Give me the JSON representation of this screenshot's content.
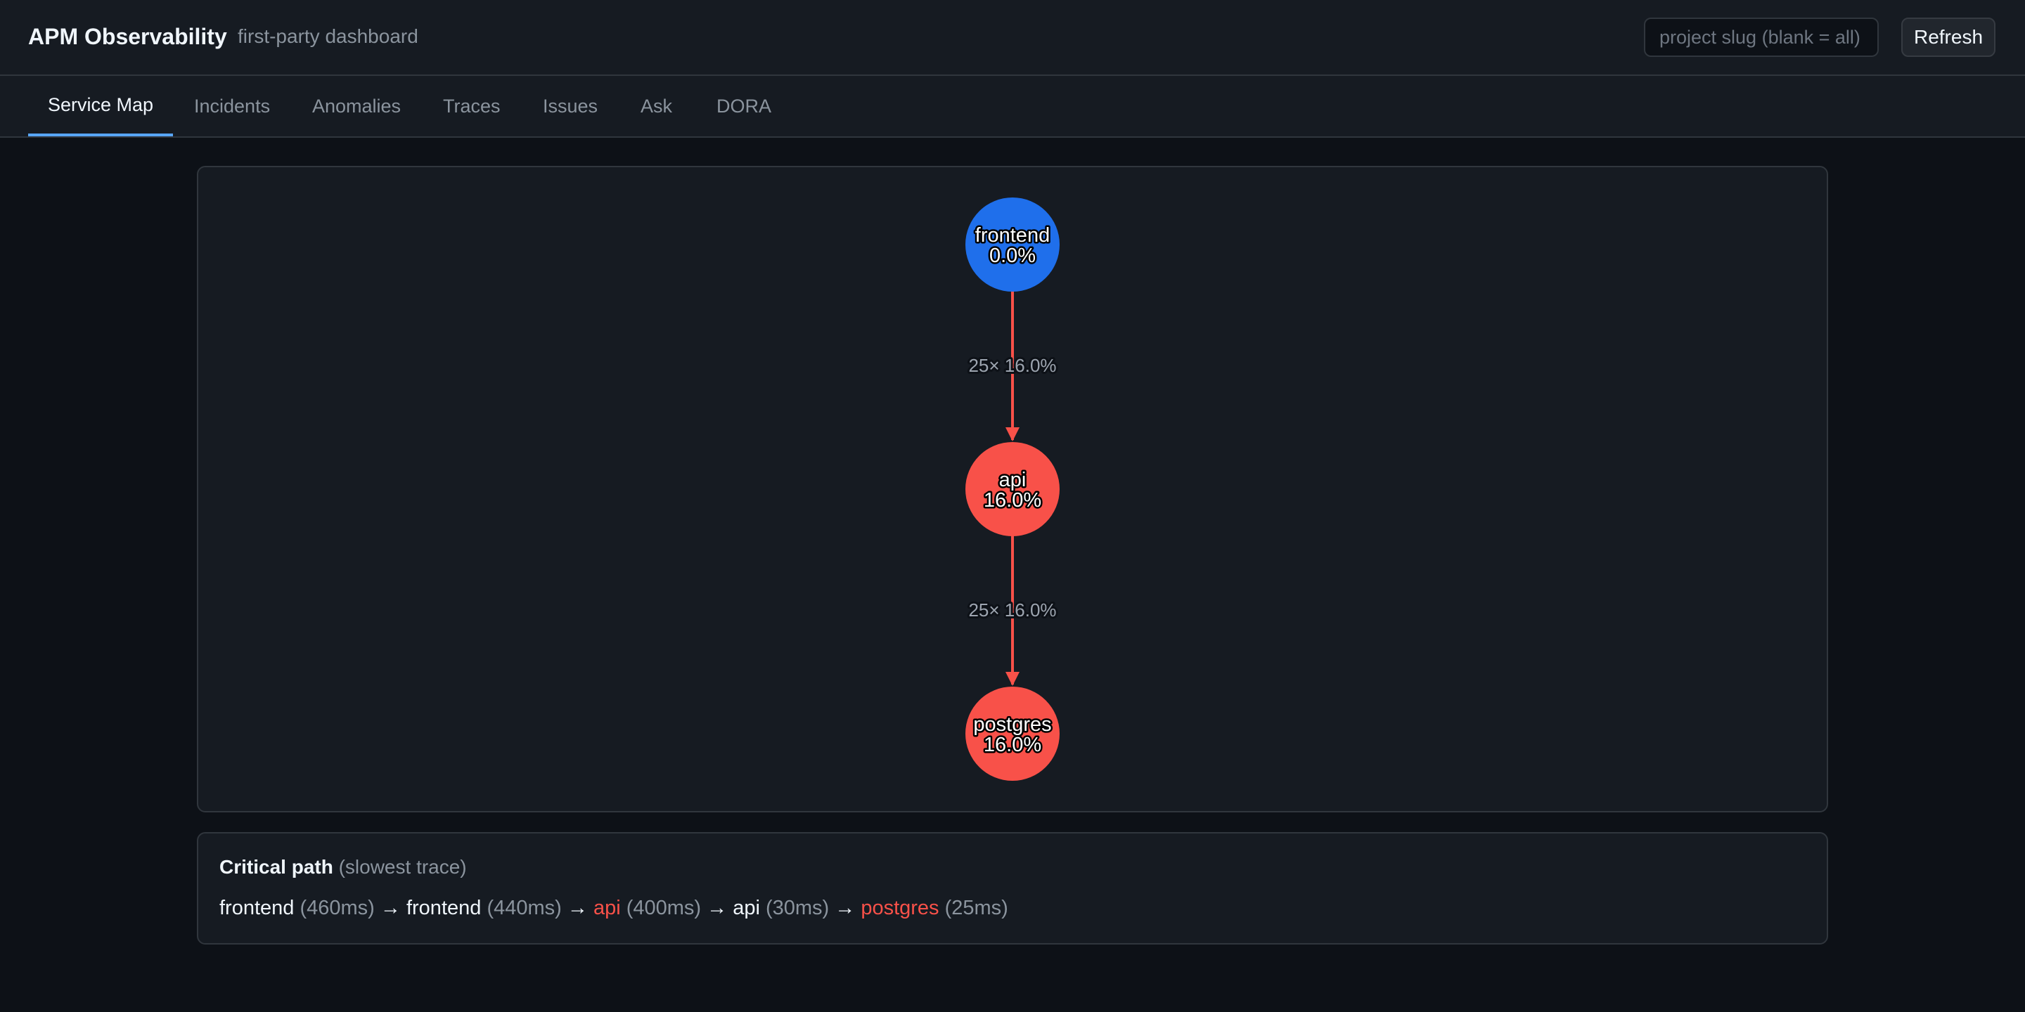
{
  "header": {
    "title": "APM Observability",
    "subtitle": "first-party dashboard",
    "project_input": {
      "value": "",
      "placeholder": "project slug (blank = all)"
    },
    "refresh_label": "Refresh"
  },
  "tabs": [
    {
      "label": "Service Map",
      "active": true
    },
    {
      "label": "Incidents",
      "active": false
    },
    {
      "label": "Anomalies",
      "active": false
    },
    {
      "label": "Traces",
      "active": false
    },
    {
      "label": "Issues",
      "active": false
    },
    {
      "label": "Ask",
      "active": false
    },
    {
      "label": "DORA",
      "active": false
    }
  ],
  "service_map": {
    "nodes": [
      {
        "name": "frontend",
        "error_rate": "0.0%",
        "status": "ok"
      },
      {
        "name": "api",
        "error_rate": "16.0%",
        "status": "error"
      },
      {
        "name": "postgres",
        "error_rate": "16.0%",
        "status": "error"
      }
    ],
    "edges": [
      {
        "from": "frontend",
        "to": "api",
        "label": "25× 16.0%"
      },
      {
        "from": "api",
        "to": "postgres",
        "label": "25× 16.0%"
      }
    ]
  },
  "critical_path": {
    "title": "Critical path",
    "note": "(slowest trace)",
    "arrow": "→",
    "segments": [
      {
        "service": "frontend",
        "duration": "(460ms)",
        "error": false
      },
      {
        "service": "frontend",
        "duration": "(440ms)",
        "error": false
      },
      {
        "service": "api",
        "duration": "(400ms)",
        "error": true
      },
      {
        "service": "api",
        "duration": "(30ms)",
        "error": false
      },
      {
        "service": "postgres",
        "duration": "(25ms)",
        "error": true
      }
    ]
  },
  "colors": {
    "ok": "#1f6feb",
    "error": "#f85149",
    "accent": "#58a6ff"
  }
}
